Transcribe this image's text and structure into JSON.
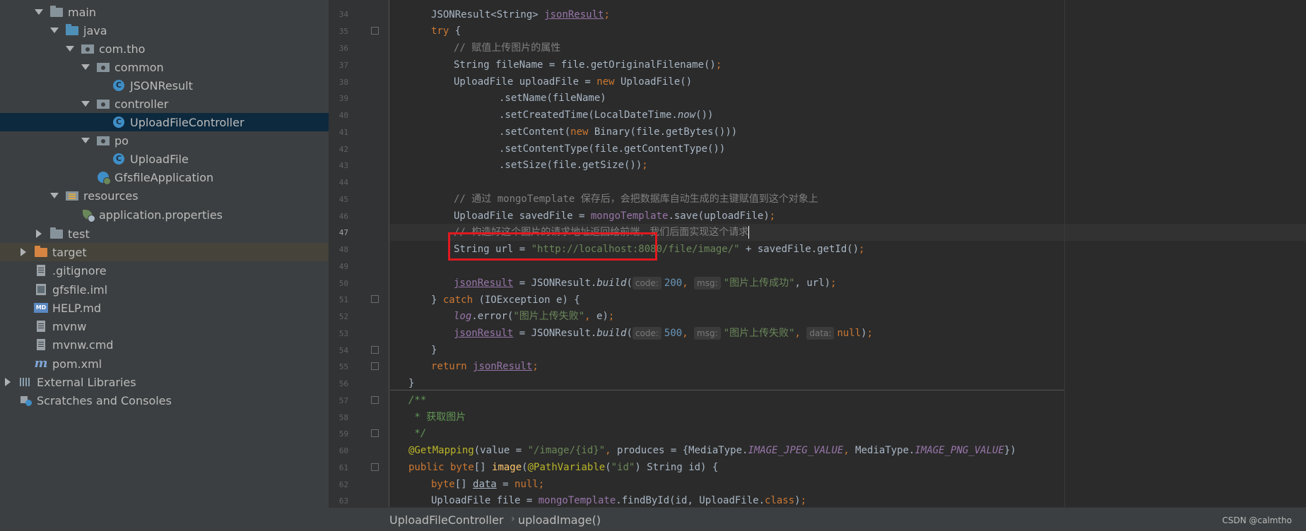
{
  "project_tree": {
    "items": [
      {
        "label": "main",
        "icon": "folder-icon"
      },
      {
        "label": "java",
        "icon": "source-folder-icon"
      },
      {
        "label": "com.tho",
        "icon": "package-icon"
      },
      {
        "label": "common",
        "icon": "package-icon"
      },
      {
        "label": "JSONResult",
        "icon": "class-icon"
      },
      {
        "label": "controller",
        "icon": "package-icon"
      },
      {
        "label": "UploadFileController",
        "icon": "class-icon"
      },
      {
        "label": "po",
        "icon": "package-icon"
      },
      {
        "label": "UploadFile",
        "icon": "class-icon"
      },
      {
        "label": "GfsfileApplication",
        "icon": "spring-boot-class-icon"
      },
      {
        "label": "resources",
        "icon": "resources-folder-icon"
      },
      {
        "label": "application.properties",
        "icon": "spring-properties-icon"
      },
      {
        "label": "test",
        "icon": "folder-icon"
      },
      {
        "label": "target",
        "icon": "excluded-folder-icon"
      },
      {
        "label": ".gitignore",
        "icon": "text-file-icon"
      },
      {
        "label": "gfsfile.iml",
        "icon": "module-file-icon"
      },
      {
        "label": "HELP.md",
        "icon": "markdown-file-icon"
      },
      {
        "label": "mvnw",
        "icon": "text-file-icon"
      },
      {
        "label": "mvnw.cmd",
        "icon": "text-file-icon"
      },
      {
        "label": "pom.xml",
        "icon": "maven-icon"
      },
      {
        "label": "External Libraries",
        "icon": "libraries-icon"
      },
      {
        "label": "Scratches and Consoles",
        "icon": "scratches-icon"
      }
    ]
  },
  "editor": {
    "line_numbers": [
      "34",
      "35",
      "36",
      "37",
      "38",
      "39",
      "40",
      "41",
      "42",
      "43",
      "44",
      "45",
      "46",
      "47",
      "48",
      "49",
      "50",
      "51",
      "52",
      "53",
      "54",
      "55",
      "56",
      "57",
      "58",
      "59",
      "60",
      "61",
      "62",
      "63"
    ],
    "code": {
      "l34": {
        "type": "JSONResult<String> ",
        "var": "jsonResult",
        "end": ";"
      },
      "l35": {
        "kw": "try",
        "rest": " {"
      },
      "l36": {
        "comment": "// 赋值上传图片的属性"
      },
      "l37": {
        "a": "String fileName = file.getOriginalFilename()",
        "end": ";"
      },
      "l38": {
        "a": "UploadFile uploadFile = ",
        "kw": "new",
        "b": " UploadFile()"
      },
      "l39": {
        "a": ".setName(fileName)"
      },
      "l40": {
        "a": ".setCreatedTime(LocalDateTime.",
        "ital": "now",
        "b": "())"
      },
      "l41": {
        "a": ".setContent(",
        "kw": "new",
        "b": " Binary(file.getBytes()))"
      },
      "l42": {
        "a": ".setContentType(file.getContentType())"
      },
      "l43": {
        "a": ".setSize(file.getSize())",
        "end": ";"
      },
      "l45": {
        "comment": "// 通过 mongoTemplate 保存后，会把数据库自动生成的主键赋值到这个对象上"
      },
      "l46": {
        "a": "UploadFile savedFile = ",
        "field": "mongoTemplate",
        "b": ".save(uploadFile)",
        "end": ";"
      },
      "l47": {
        "comment": "// 构造好这个图片的请求地址返回给前端，我们后面实现这个请求"
      },
      "l48": {
        "a": "String url = ",
        "str": "\"http://localhost:8080/file/image/\"",
        "b": " + savedFile.getId()",
        "end": ";"
      },
      "l50": {
        "var": "jsonResult",
        "a": " = JSONResult.",
        "ital": "build",
        "b": "(",
        "hint1": "code:",
        "num1": "200",
        "sep": ", ",
        "hint2": "msg:",
        "str": "\"图片上传成功\"",
        "c": ", url)",
        "end": ";"
      },
      "l51": {
        "a": "} ",
        "kw": "catch",
        "b": " (IOException e) {"
      },
      "l52": {
        "field": "log",
        "a": ".error(",
        "str": "\"图片上传失败\"",
        "sep": ", ",
        "b": "e)",
        "end": ";"
      },
      "l53": {
        "var": "jsonResult",
        "a": " = JSONResult.",
        "ital": "build",
        "b": "(",
        "hint1": "code:",
        "num1": "500",
        "sep": ", ",
        "hint2": "msg:",
        "str": "\"图片上传失败\"",
        "sep2": ", ",
        "hint3": "data:",
        "kw": "null",
        "c": ")",
        "end": ";"
      },
      "l54": {
        "a": "}"
      },
      "l55": {
        "kw": "return",
        "b": " ",
        "var": "jsonResult",
        "end": ";"
      },
      "l56": {
        "a": "}"
      },
      "l57": {
        "doc": "/**"
      },
      "l58": {
        "doc": " * 获取图片"
      },
      "l59": {
        "doc": " */"
      },
      "l60": {
        "ann": "@GetMapping",
        "a": "(value = ",
        "str": "\"/image/{id}\"",
        "sep": ", ",
        "b": "produces = {MediaType.",
        "const1": "IMAGE_JPEG_VALUE",
        "sep2": ", ",
        "c": "MediaType.",
        "const2": "IMAGE_PNG_VALUE",
        "d": "})"
      },
      "l61": {
        "kw": "public byte",
        "a": "[] ",
        "name": "image",
        "b": "(",
        "ann": "@PathVariable",
        "c": "(",
        "str": "\"id\"",
        "d": ") String id) {"
      },
      "l62": {
        "kw": "byte",
        "a": "[] ",
        "var": "data",
        "b": " = ",
        "kw2": "null",
        "end": ";"
      },
      "l63": {
        "a": "UploadFile file = ",
        "field": "mongoTemplate",
        "b": ".findById(id, UploadFile.",
        "kw": "class",
        "c": ")",
        "end": ";"
      }
    }
  },
  "breadcrumb": {
    "items": [
      "UploadFileController",
      "uploadImage()"
    ]
  },
  "watermark": "CSDN @calmtho",
  "colors": {
    "highlight_box": "#e0191f",
    "selected_row": "#0d293e",
    "keyword": "#cc7832",
    "string": "#6a8759",
    "comment": "#808080"
  }
}
